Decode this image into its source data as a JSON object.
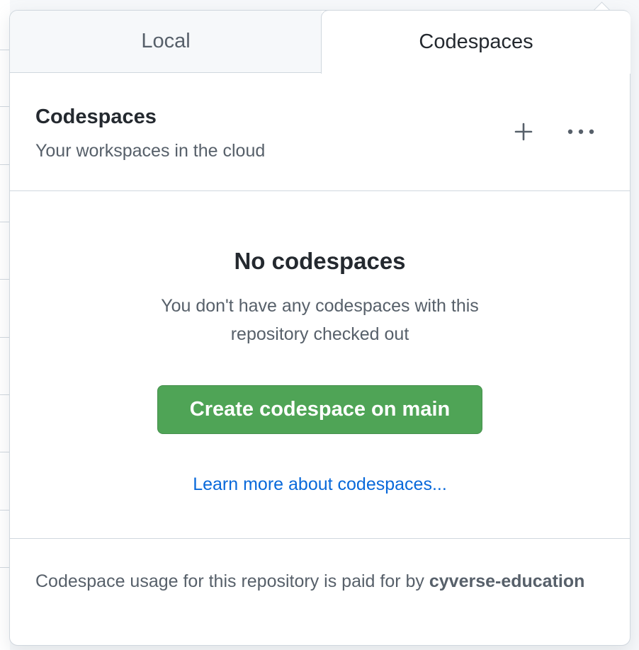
{
  "tabs": {
    "local_label": "Local",
    "codespaces_label": "Codespaces"
  },
  "header": {
    "title": "Codespaces",
    "subtitle": "Your workspaces in the cloud",
    "add_icon": "plus-icon",
    "more_icon": "kebab-horizontal-icon"
  },
  "empty_state": {
    "title": "No codespaces",
    "description": "You don't have any codespaces with this repository checked out",
    "create_button_label": "Create codespace on main",
    "learn_more_link": "Learn more about codespaces..."
  },
  "footer": {
    "note_prefix": "Codespace usage for this repository is paid for by ",
    "org_name": "cyverse-education"
  },
  "colors": {
    "primary_button": "#4fa456",
    "link": "#0969da",
    "border": "#d0d7de",
    "muted_text": "#57606a"
  }
}
